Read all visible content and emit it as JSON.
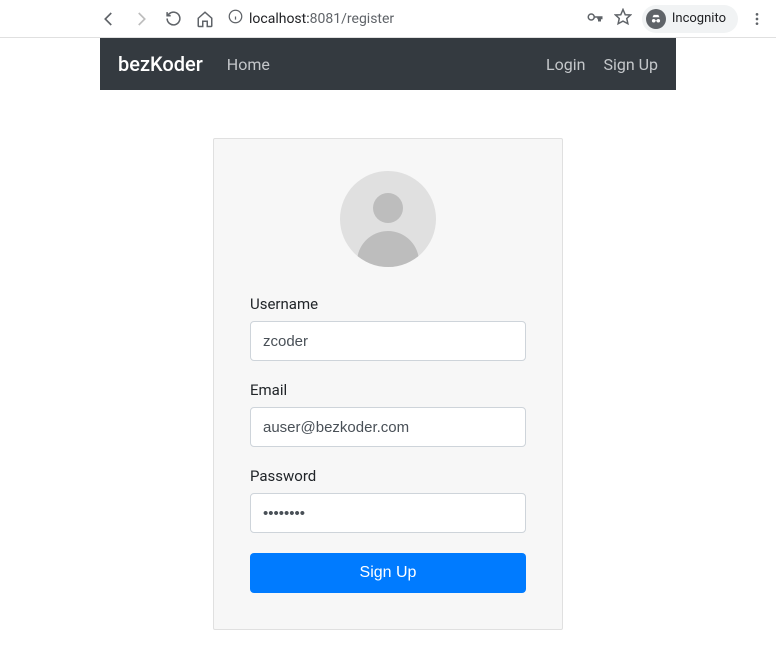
{
  "browser": {
    "url_host": "localhost:",
    "url_port": "8081",
    "url_path": "/register",
    "incognito_label": "Incognito"
  },
  "navbar": {
    "brand": "bezKoder",
    "home": "Home",
    "login": "Login",
    "signup": "Sign Up"
  },
  "form": {
    "username_label": "Username",
    "username_value": "zcoder",
    "email_label": "Email",
    "email_value": "auser@bezkoder.com",
    "password_label": "Password",
    "password_value": "••••••••",
    "submit_label": "Sign Up"
  }
}
